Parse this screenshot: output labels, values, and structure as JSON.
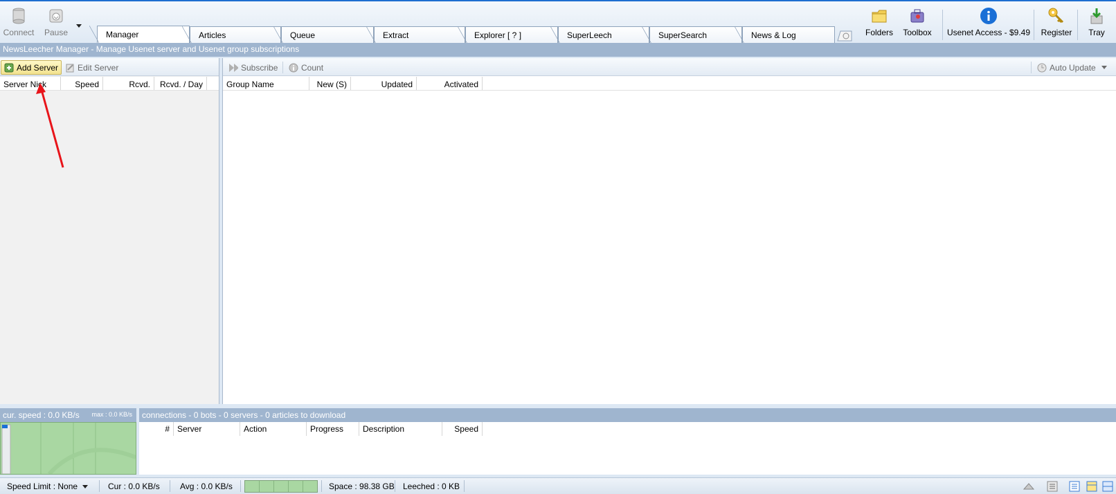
{
  "toolbar": {
    "connect": "Connect",
    "pause": "Pause",
    "folders": "Folders",
    "toolbox": "Toolbox",
    "usenet_access": "Usenet Access - $9.49",
    "register": "Register",
    "tray": "Tray"
  },
  "tabs": [
    {
      "label": "Manager"
    },
    {
      "label": "Articles"
    },
    {
      "label": "Queue"
    },
    {
      "label": "Extract"
    },
    {
      "label": "Explorer [ ? ]"
    },
    {
      "label": "SuperLeech"
    },
    {
      "label": "SuperSearch"
    },
    {
      "label": "News & Log"
    }
  ],
  "manager_title": "NewsLeecher Manager  -  Manage Usenet server and Usenet group subscriptions",
  "server_pane": {
    "add_server": "Add Server",
    "edit_server": "Edit Server",
    "columns": [
      "Server Nick",
      "Speed",
      "Rcvd.",
      "Rcvd. / Day"
    ]
  },
  "group_pane": {
    "subscribe": "Subscribe",
    "count": "Count",
    "auto_update": "Auto Update",
    "columns": [
      "Group Name",
      "New (S)",
      "Updated",
      "Activated"
    ]
  },
  "speed_panel": {
    "title": "cur. speed : 0.0 KB/s",
    "max": "max : 0.0 KB/s"
  },
  "connections_panel": {
    "title": "connections  -  0 bots  -  0 servers  -  0 articles to download",
    "columns": [
      "#",
      "Server",
      "Action",
      "Progress",
      "Description",
      "Speed"
    ]
  },
  "statusbar": {
    "speed_limit": "Speed Limit : None",
    "cur": "Cur : 0.0 KB/s",
    "avg": "Avg : 0.0 KB/s",
    "space": "Space : 98.38 GB",
    "leeched": "Leeched : 0 KB"
  },
  "colors": {
    "accent": "#1e6fd0",
    "header_blue": "#9fb5cf",
    "graph_green": "#a9d7a2",
    "arrow_red": "#e8141a"
  },
  "icons": [
    "database-icon",
    "pause-icon",
    "folder-icon",
    "toolbox-icon",
    "info-icon",
    "key-icon",
    "tray-icon",
    "add-server-icon",
    "edit-server-icon",
    "subscribe-icon",
    "count-icon",
    "auto-update-icon"
  ]
}
